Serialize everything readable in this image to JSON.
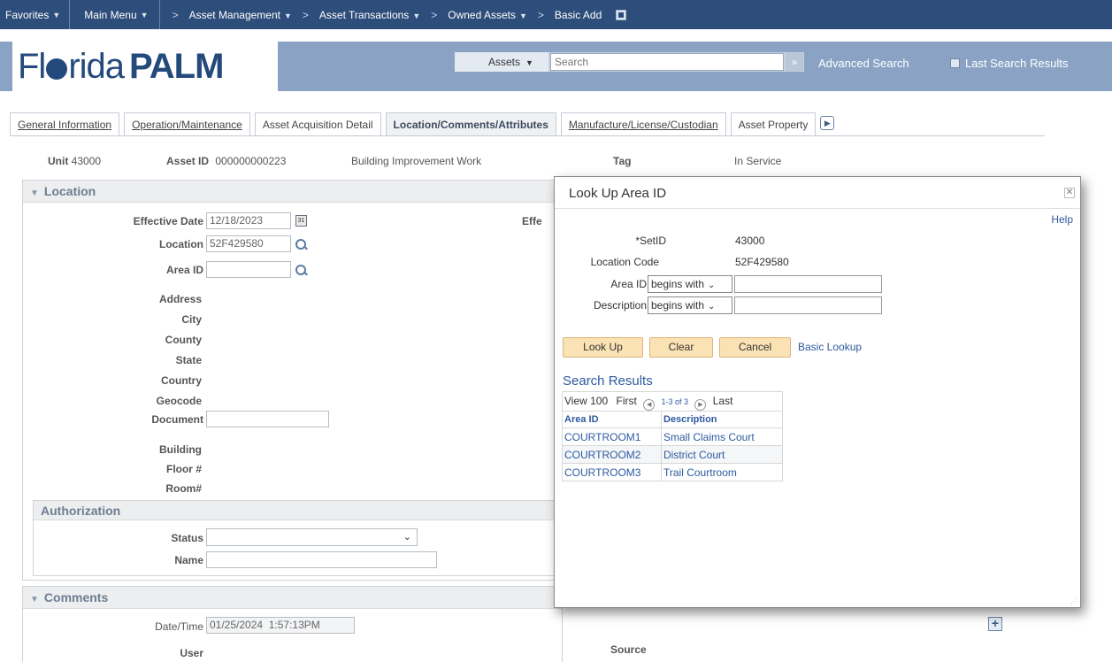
{
  "topnav": {
    "favorites": "Favorites",
    "main_menu": "Main Menu",
    "breadcrumb": [
      "Asset Management",
      "Asset Transactions",
      "Owned Assets",
      "Basic Add"
    ]
  },
  "header": {
    "logo_light": "Fl",
    "logo_light2": "rida",
    "logo_bold": "PALM",
    "search_category": "Assets",
    "search_placeholder": "Search",
    "advanced_search": "Advanced Search",
    "last_search_results": "Last Search Results"
  },
  "tabs": [
    {
      "label": "General Information",
      "active": false
    },
    {
      "label": "Operation/Maintenance",
      "active": false
    },
    {
      "label": "Asset Acquisition Detail",
      "active": false
    },
    {
      "label": "Location/Comments/Attributes",
      "active": true
    },
    {
      "label": "Manufacture/License/Custodian",
      "active": false
    },
    {
      "label": "Asset Property",
      "active": false
    }
  ],
  "asset": {
    "unit_label": "Unit",
    "unit_value": "43000",
    "asset_id_label": "Asset ID",
    "asset_id_value": "000000000223",
    "description": "Building Improvement Work",
    "tag_label": "Tag",
    "status": "In Service"
  },
  "location": {
    "title": "Location",
    "effective_date_label": "Effective Date",
    "effective_date": "12/18/2023",
    "effe_truncated": "Effe",
    "location_label": "Location",
    "location_value": "52F429580",
    "area_id_label": "Area ID",
    "area_id_value": "",
    "address_label": "Address",
    "city_label": "City",
    "county_label": "County",
    "state_label": "State",
    "country_label": "Country",
    "geocode_label": "Geocode",
    "document_label": "Document",
    "building_label": "Building",
    "floor_label": "Floor #",
    "room_label": "Room#"
  },
  "authorization": {
    "title": "Authorization",
    "status_label": "Status",
    "status_value": "",
    "name_label": "Name",
    "name_value": ""
  },
  "comments": {
    "title": "Comments",
    "datetime_label": "Date/Time",
    "datetime_value": "01/25/2024  1:57:13PM",
    "user_label": "User",
    "source_label": "Source"
  },
  "modal": {
    "title": "Look Up Area ID",
    "help": "Help",
    "setid_label": "*SetID",
    "setid_value": "43000",
    "location_code_label": "Location Code",
    "location_code_value": "52F429580",
    "area_id_label": "Area ID",
    "area_id_operator": "begins with",
    "description_label": "Description",
    "description_operator": "begins with",
    "lookup_button": "Look Up",
    "clear_button": "Clear",
    "cancel_button": "Cancel",
    "basic_lookup": "Basic Lookup",
    "search_results_title": "Search Results",
    "view_all": "View 100",
    "first": "First",
    "range": "1-3 of 3",
    "last": "Last",
    "columns": [
      "Area ID",
      "Description"
    ],
    "rows": [
      [
        "COURTROOM1",
        "Small Claims Court"
      ],
      [
        "COURTROOM2",
        "District Court"
      ],
      [
        "COURTROOM3",
        "Trail Courtroom"
      ]
    ]
  }
}
